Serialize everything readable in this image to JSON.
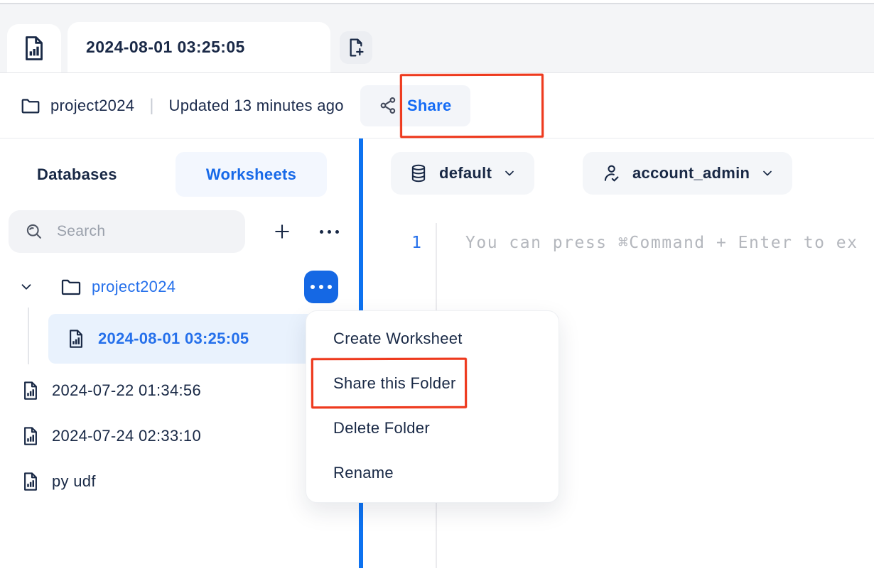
{
  "tabs": {
    "active_tab": "2024-08-01 03:25:05"
  },
  "breadcrumb": {
    "folder": "project2024",
    "separator": "|",
    "updated": "Updated 13 minutes ago",
    "share_label": "Share"
  },
  "sidebar": {
    "tabs": [
      {
        "label": "Databases",
        "active": false
      },
      {
        "label": "Worksheets",
        "active": true
      }
    ],
    "search_placeholder": "Search",
    "tree": {
      "folder_label": "project2024",
      "selected_label": "2024-08-01 03:25:05",
      "items": [
        {
          "label": "2024-07-22 01:34:56"
        },
        {
          "label": "2024-07-24 02:33:10"
        },
        {
          "label": "py udf"
        }
      ]
    }
  },
  "context_menu": {
    "items": [
      {
        "label": "Create Worksheet",
        "highlighted": false
      },
      {
        "label": "Share this Folder",
        "highlighted": true
      },
      {
        "label": "Delete Folder",
        "highlighted": false
      },
      {
        "label": "Rename",
        "highlighted": false
      }
    ]
  },
  "editor": {
    "database_selector": "default",
    "role_selector": "account_admin",
    "line_number": "1",
    "placeholder": "You can press ⌘Command + Enter to ex"
  },
  "icons": {
    "tab_home": "worksheet-chart-icon",
    "tab_new": "file-plus-icon",
    "breadcrumb": "folder-icon",
    "share": "share-network-icon",
    "search": "search-icon",
    "database": "database-icon",
    "role": "user-check-icon"
  },
  "colors": {
    "accent_blue": "#1769e8",
    "divider_blue": "#0d72f0",
    "annotation_red": "#ee3a1e",
    "dark_navy": "#182845",
    "selected_row_bg": "#e9f2fd"
  }
}
